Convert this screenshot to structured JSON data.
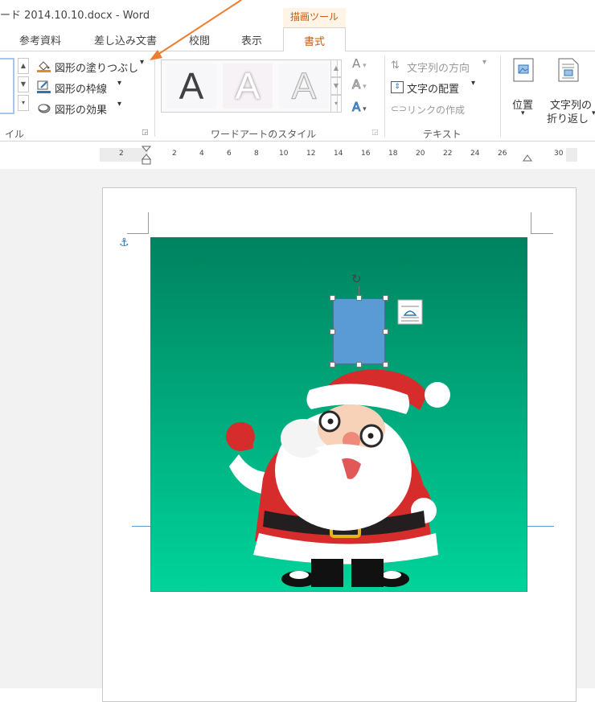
{
  "window": {
    "title": "ード 2014.10.10.docx - Word",
    "context_group": "描画ツール"
  },
  "tabs": [
    {
      "label": "参考資料",
      "active": false
    },
    {
      "label": "差し込み文書",
      "active": false
    },
    {
      "label": "校閲",
      "active": false
    },
    {
      "label": "表示",
      "active": false
    },
    {
      "label": "書式",
      "active": true
    }
  ],
  "ribbon": {
    "shape_styles": {
      "group_label": "イル",
      "fill": "図形の塗りつぶし",
      "outline": "図形の枠線",
      "effects": "図形の効果"
    },
    "wordart": {
      "group_label": "ワードアートのスタイル",
      "samples": [
        "A",
        "A",
        "A"
      ]
    },
    "text": {
      "group_label": "テキスト",
      "direction": "文字列の方向",
      "align": "文字の配置",
      "link": "リンクの作成"
    },
    "arrange": {
      "position": "位置",
      "wrap_line1": "文字列の",
      "wrap_line2": "折り返し"
    }
  },
  "ruler": {
    "ticks": [
      "2",
      "2",
      "4",
      "6",
      "8",
      "10",
      "12",
      "14",
      "16",
      "18",
      "20",
      "22",
      "24",
      "26",
      "30"
    ]
  },
  "colors": {
    "accent": "#c55a11",
    "annotation_arrow": "#ed7d31",
    "shape_fill": "#5b9bd5",
    "image_top": "#00825f",
    "image_bottom": "#00d49b"
  }
}
